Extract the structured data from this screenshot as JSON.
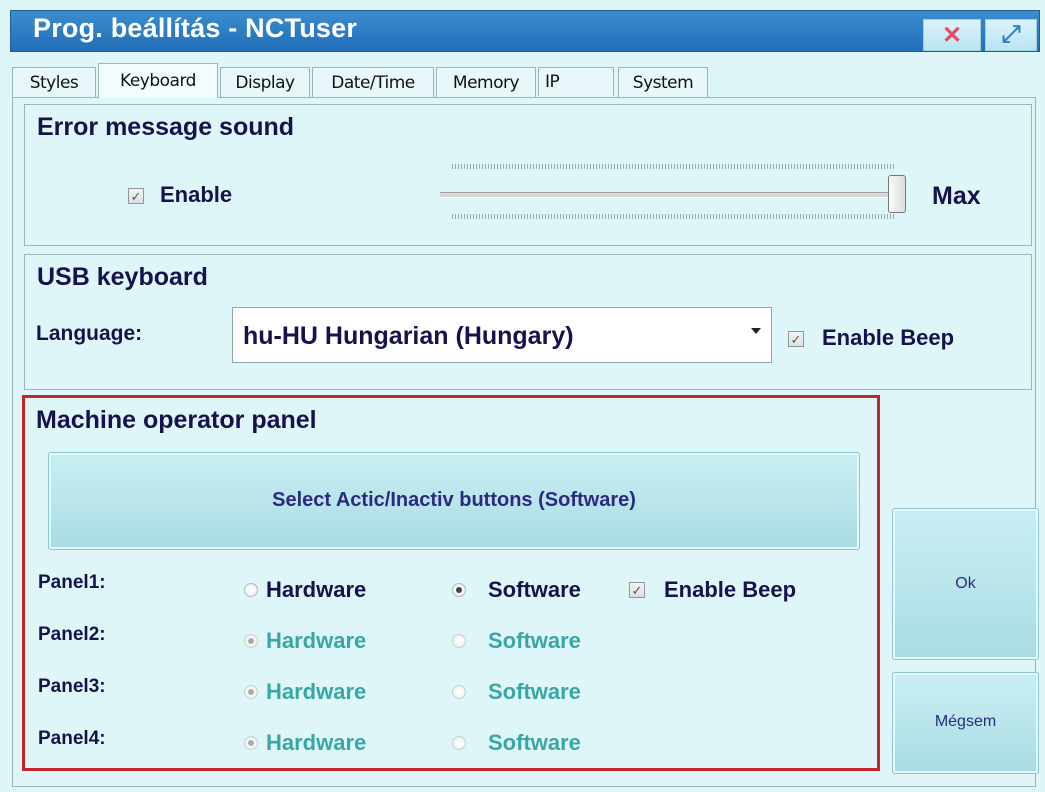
{
  "window": {
    "title": "Prog. beállítás - NCTuser",
    "close_glyph": "✕",
    "maximize_glyph": "⤢"
  },
  "tabs": [
    {
      "label": "Styles"
    },
    {
      "label": "Keyboard"
    },
    {
      "label": "Display"
    },
    {
      "label": "Date/Time"
    },
    {
      "label": "Memory"
    },
    {
      "label": "IP"
    },
    {
      "label": "System"
    }
  ],
  "active_tab": "Keyboard",
  "error_sound": {
    "title": "Error message sound",
    "enable_label": "Enable",
    "enable_checked": true,
    "level_label": "Max",
    "level_fraction": 1.0
  },
  "usb_keyboard": {
    "title": "USB keyboard",
    "language_label": "Language:",
    "language_value": "hu-HU Hungarian (Hungary)",
    "enable_beep_label": "Enable Beep",
    "enable_beep_checked": true
  },
  "operator_panel": {
    "title": "Machine operator panel",
    "select_button_label": "Select Actic/Inactiv buttons (Software)",
    "panels": [
      {
        "label": "Panel1:",
        "hardware": "Hardware",
        "software": "Software",
        "selected": "software",
        "enabled": true,
        "beep_label": "Enable Beep",
        "beep_checked": true
      },
      {
        "label": "Panel2:",
        "hardware": "Hardware",
        "software": "Software",
        "selected": "hardware",
        "enabled": false
      },
      {
        "label": "Panel3:",
        "hardware": "Hardware",
        "software": "Software",
        "selected": "hardware",
        "enabled": false
      },
      {
        "label": "Panel4:",
        "hardware": "Hardware",
        "software": "Software",
        "selected": "hardware",
        "enabled": false
      }
    ]
  },
  "buttons": {
    "ok_label": "Ok",
    "cancel_label": "Mégsem"
  },
  "check_glyph": "✓"
}
